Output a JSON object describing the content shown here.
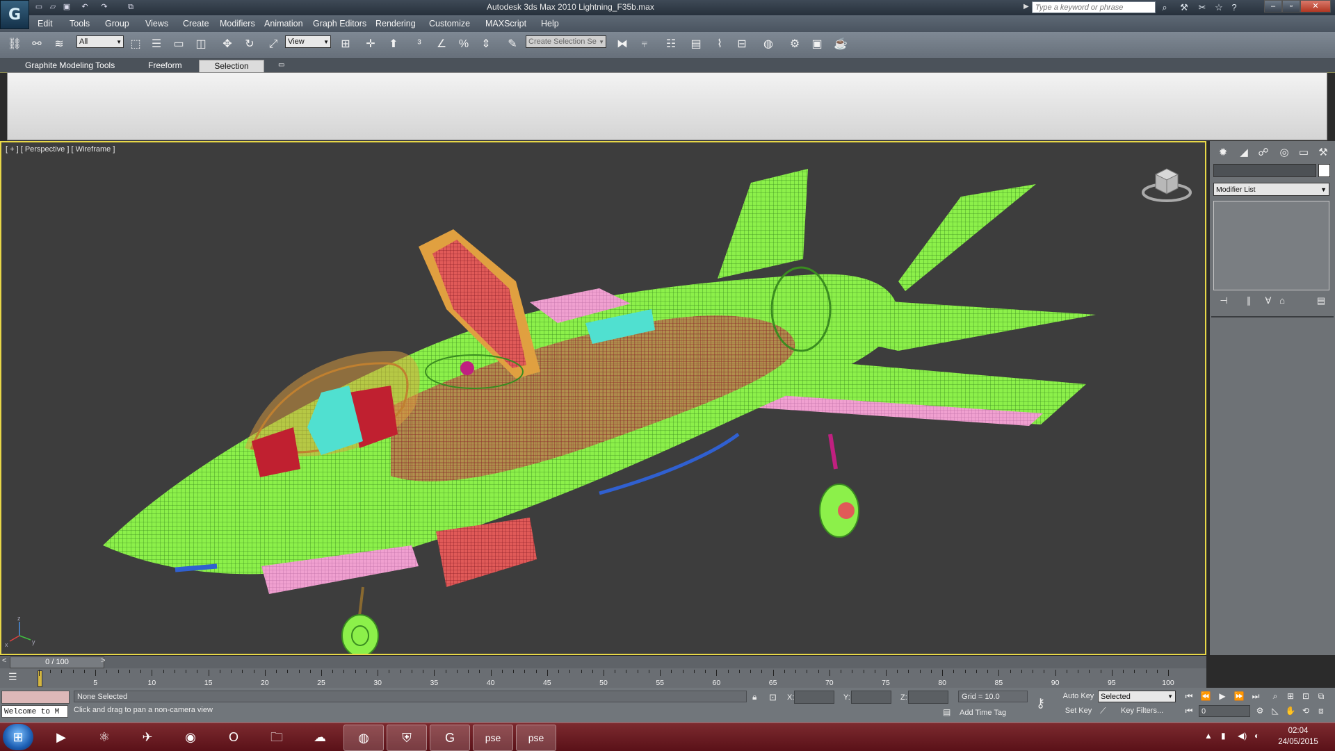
{
  "window": {
    "title": "Autodesk 3ds Max  2010      Lightning_F35b.max",
    "search_placeholder": "Type a keyword or phrase",
    "logo_glyph": "G"
  },
  "menu": [
    "Edit",
    "Tools",
    "Group",
    "Views",
    "Create",
    "Modifiers",
    "Animation",
    "Graph Editors",
    "Rendering",
    "Customize",
    "MAXScript",
    "Help"
  ],
  "toolbar": {
    "selection_filter": "All",
    "reference_coord": "View",
    "named_selection": "Create Selection Se"
  },
  "ribbon": {
    "tabs": [
      "Graphite Modeling Tools",
      "Freeform",
      "Selection"
    ],
    "active_tab": "Selection"
  },
  "viewport": {
    "label": "[ + ] [ Perspective ] [ Wireframe ]",
    "axis_labels": [
      "z",
      "x",
      "y"
    ],
    "wire_colors": {
      "fuselage": "#8cf04a",
      "canopy": "#e0a040",
      "internals": "#d04050",
      "pink": "#f0a0d0",
      "cyan": "#50e0d0",
      "blue": "#3060d0"
    }
  },
  "command_panel": {
    "modifier_list": "Modifier List"
  },
  "timeline": {
    "position": "0 / 100",
    "ticks": [
      "5",
      "10",
      "15",
      "20",
      "25",
      "30",
      "35",
      "40",
      "45",
      "50",
      "55",
      "60",
      "65",
      "70",
      "75",
      "80",
      "85",
      "90",
      "95",
      "100"
    ]
  },
  "status": {
    "listener": "Welcome to M",
    "selection": "None Selected",
    "prompt": "Click and drag to pan a non-camera view",
    "x_label": "X:",
    "y_label": "Y:",
    "z_label": "Z:",
    "grid": "Grid = 10.0",
    "add_time_tag": "Add Time Tag",
    "auto_key": "Auto Key",
    "set_key": "Set Key",
    "key_mode": "Selected",
    "key_filters": "Key Filters...",
    "frame": "0"
  },
  "taskbar": {
    "apps": [
      "media-player",
      "steam-like",
      "bird",
      "chrome",
      "opera",
      "explorer",
      "network",
      "spotify",
      "shield",
      "3dsmax",
      "pse",
      "pse"
    ],
    "pse_label": "pse",
    "time": "02:04",
    "date": "24/05/2015"
  }
}
